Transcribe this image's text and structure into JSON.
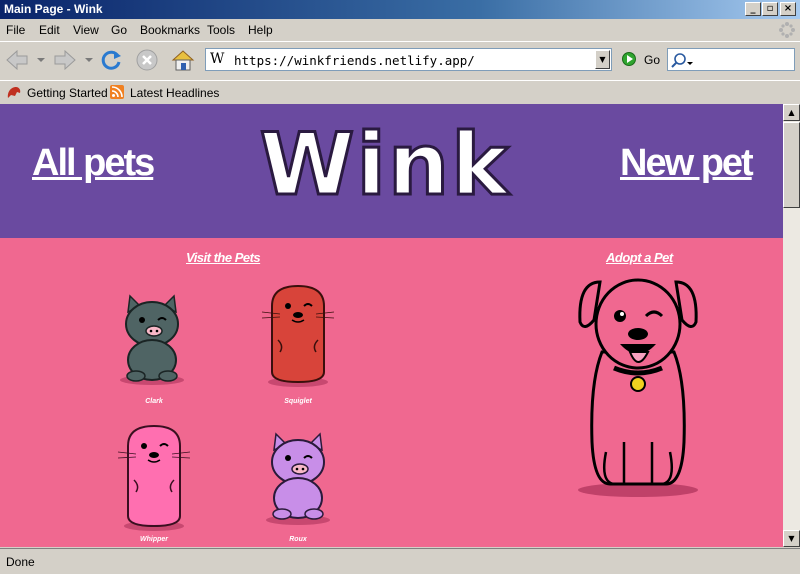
{
  "window": {
    "title": "Main Page - Wink",
    "controls": [
      "minimize",
      "maximize",
      "close"
    ]
  },
  "menu": {
    "items": [
      "File",
      "Edit",
      "View",
      "Go",
      "Bookmarks",
      "Tools",
      "Help"
    ]
  },
  "toolbar": {
    "url": "https://winkfriends.netlify.app/",
    "go_label": "Go",
    "site_icon": "W"
  },
  "bookmarks": {
    "items": [
      "Getting Started",
      "Latest Headlines"
    ]
  },
  "page": {
    "nav_left": "All pets",
    "nav_right": "New pet",
    "logo_text": "Wink",
    "visit_title": "Visit the Pets",
    "adopt_title": "Adopt a Pet",
    "pets": [
      {
        "name": "Clark",
        "kind": "pig",
        "color": "#4f6464"
      },
      {
        "name": "Squiglet",
        "kind": "otter",
        "color": "#d8443a"
      },
      {
        "name": "Whipper",
        "kind": "otter",
        "color": "#ff6fb0"
      },
      {
        "name": "Roux",
        "kind": "pig",
        "color": "#c88ee8"
      }
    ],
    "header_color": "#6a4aa0",
    "body_color": "#f06890"
  },
  "status": {
    "text": "Done"
  }
}
